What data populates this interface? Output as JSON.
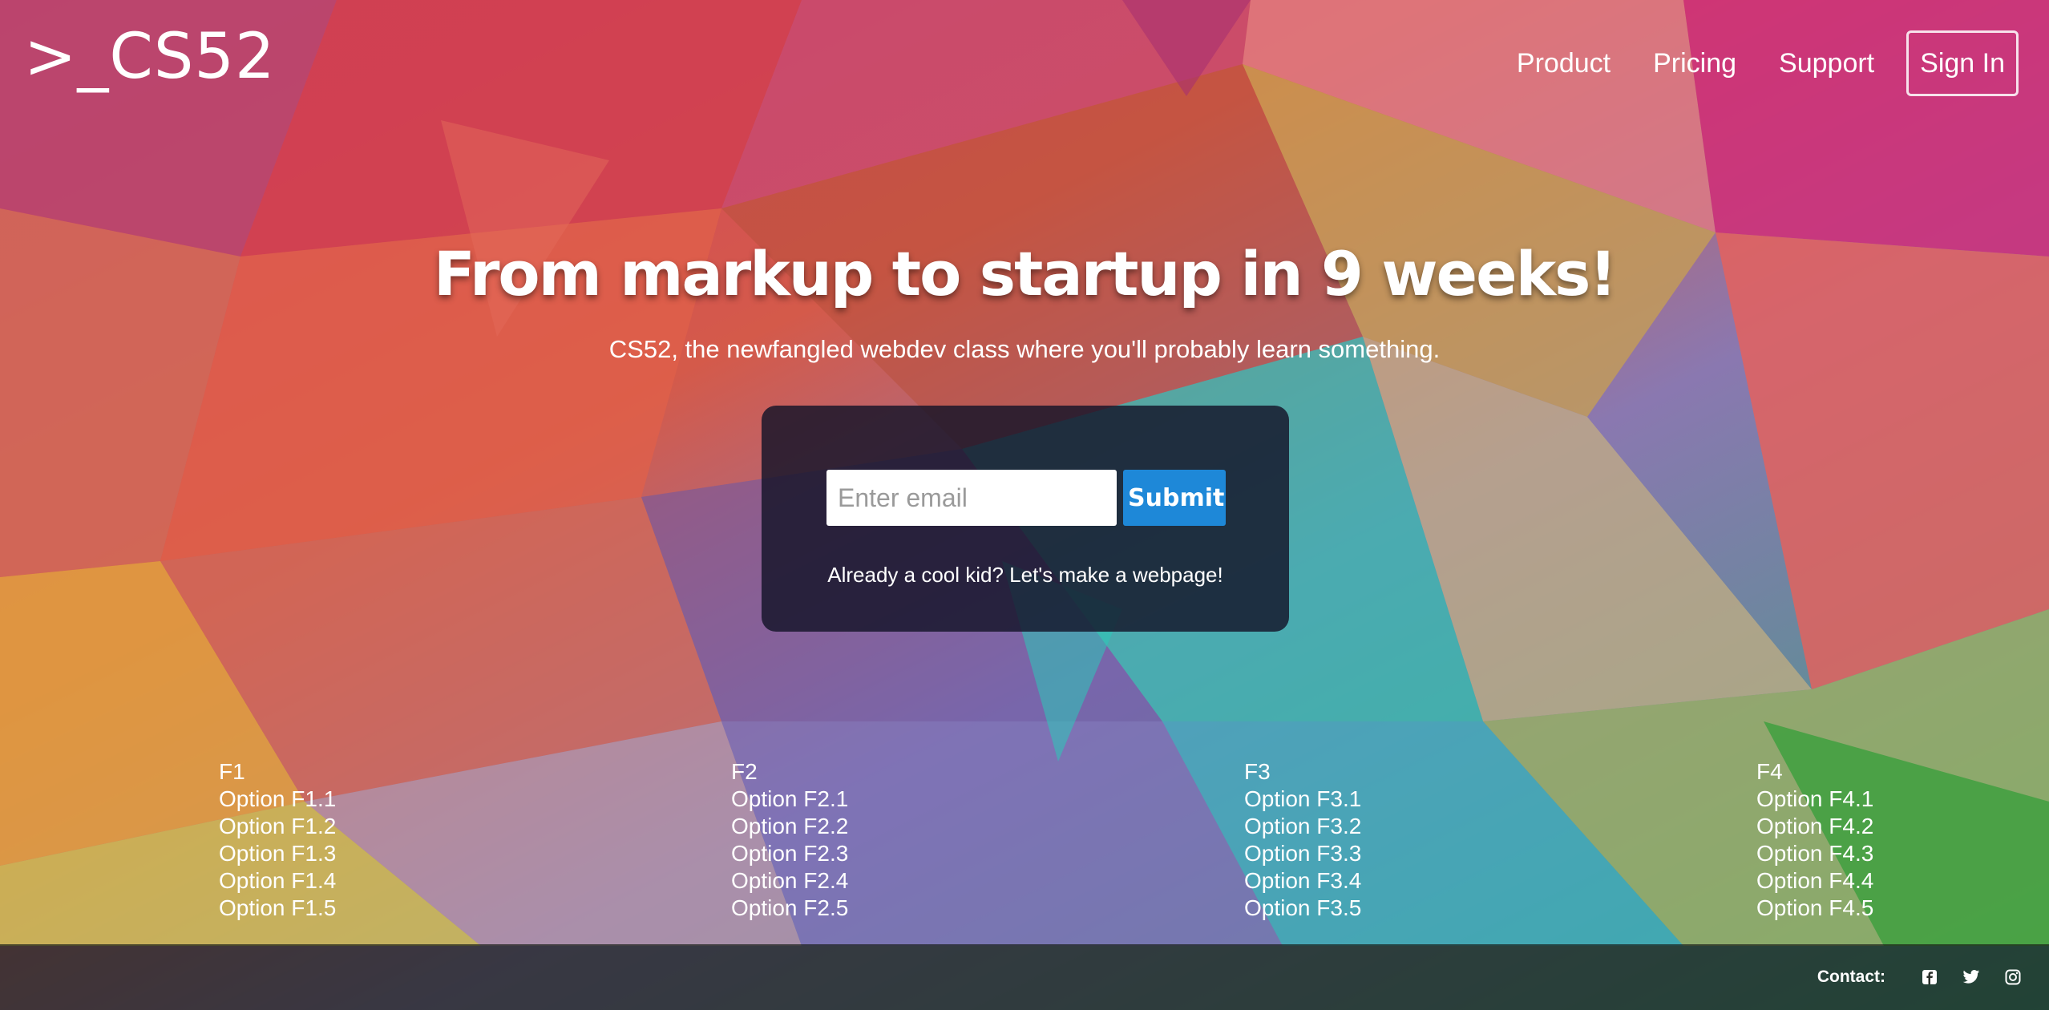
{
  "header": {
    "logo": ">_CS52",
    "nav": [
      "Product",
      "Pricing",
      "Support"
    ],
    "sign_in": "Sign In"
  },
  "hero": {
    "title": "From markup to startup in 9 weeks!",
    "subtitle": "CS52, the newfangled webdev class where you'll probably learn something."
  },
  "signup": {
    "email_placeholder": "Enter email",
    "submit_label": "Submit",
    "link_text": "Already a cool kid? Let's make a webpage!"
  },
  "footer_columns": [
    {
      "heading": "F1",
      "options": [
        "Option F1.1",
        "Option F1.2",
        "Option F1.3",
        "Option F1.4",
        "Option F1.5"
      ]
    },
    {
      "heading": "F2",
      "options": [
        "Option F2.1",
        "Option F2.2",
        "Option F2.3",
        "Option F2.4",
        "Option F2.5"
      ]
    },
    {
      "heading": "F3",
      "options": [
        "Option F3.1",
        "Option F3.2",
        "Option F3.3",
        "Option F3.4",
        "Option F3.5"
      ]
    },
    {
      "heading": "F4",
      "options": [
        "Option F4.1",
        "Option F4.2",
        "Option F4.3",
        "Option F4.4",
        "Option F4.5"
      ]
    }
  ],
  "footer": {
    "contact_label": "Contact:",
    "social_icons": [
      "facebook-icon",
      "twitter-icon",
      "instagram-icon"
    ]
  },
  "colors": {
    "submit_button": "#1e88d8",
    "panel_background": "#141428",
    "footer_background": "#191e19"
  }
}
